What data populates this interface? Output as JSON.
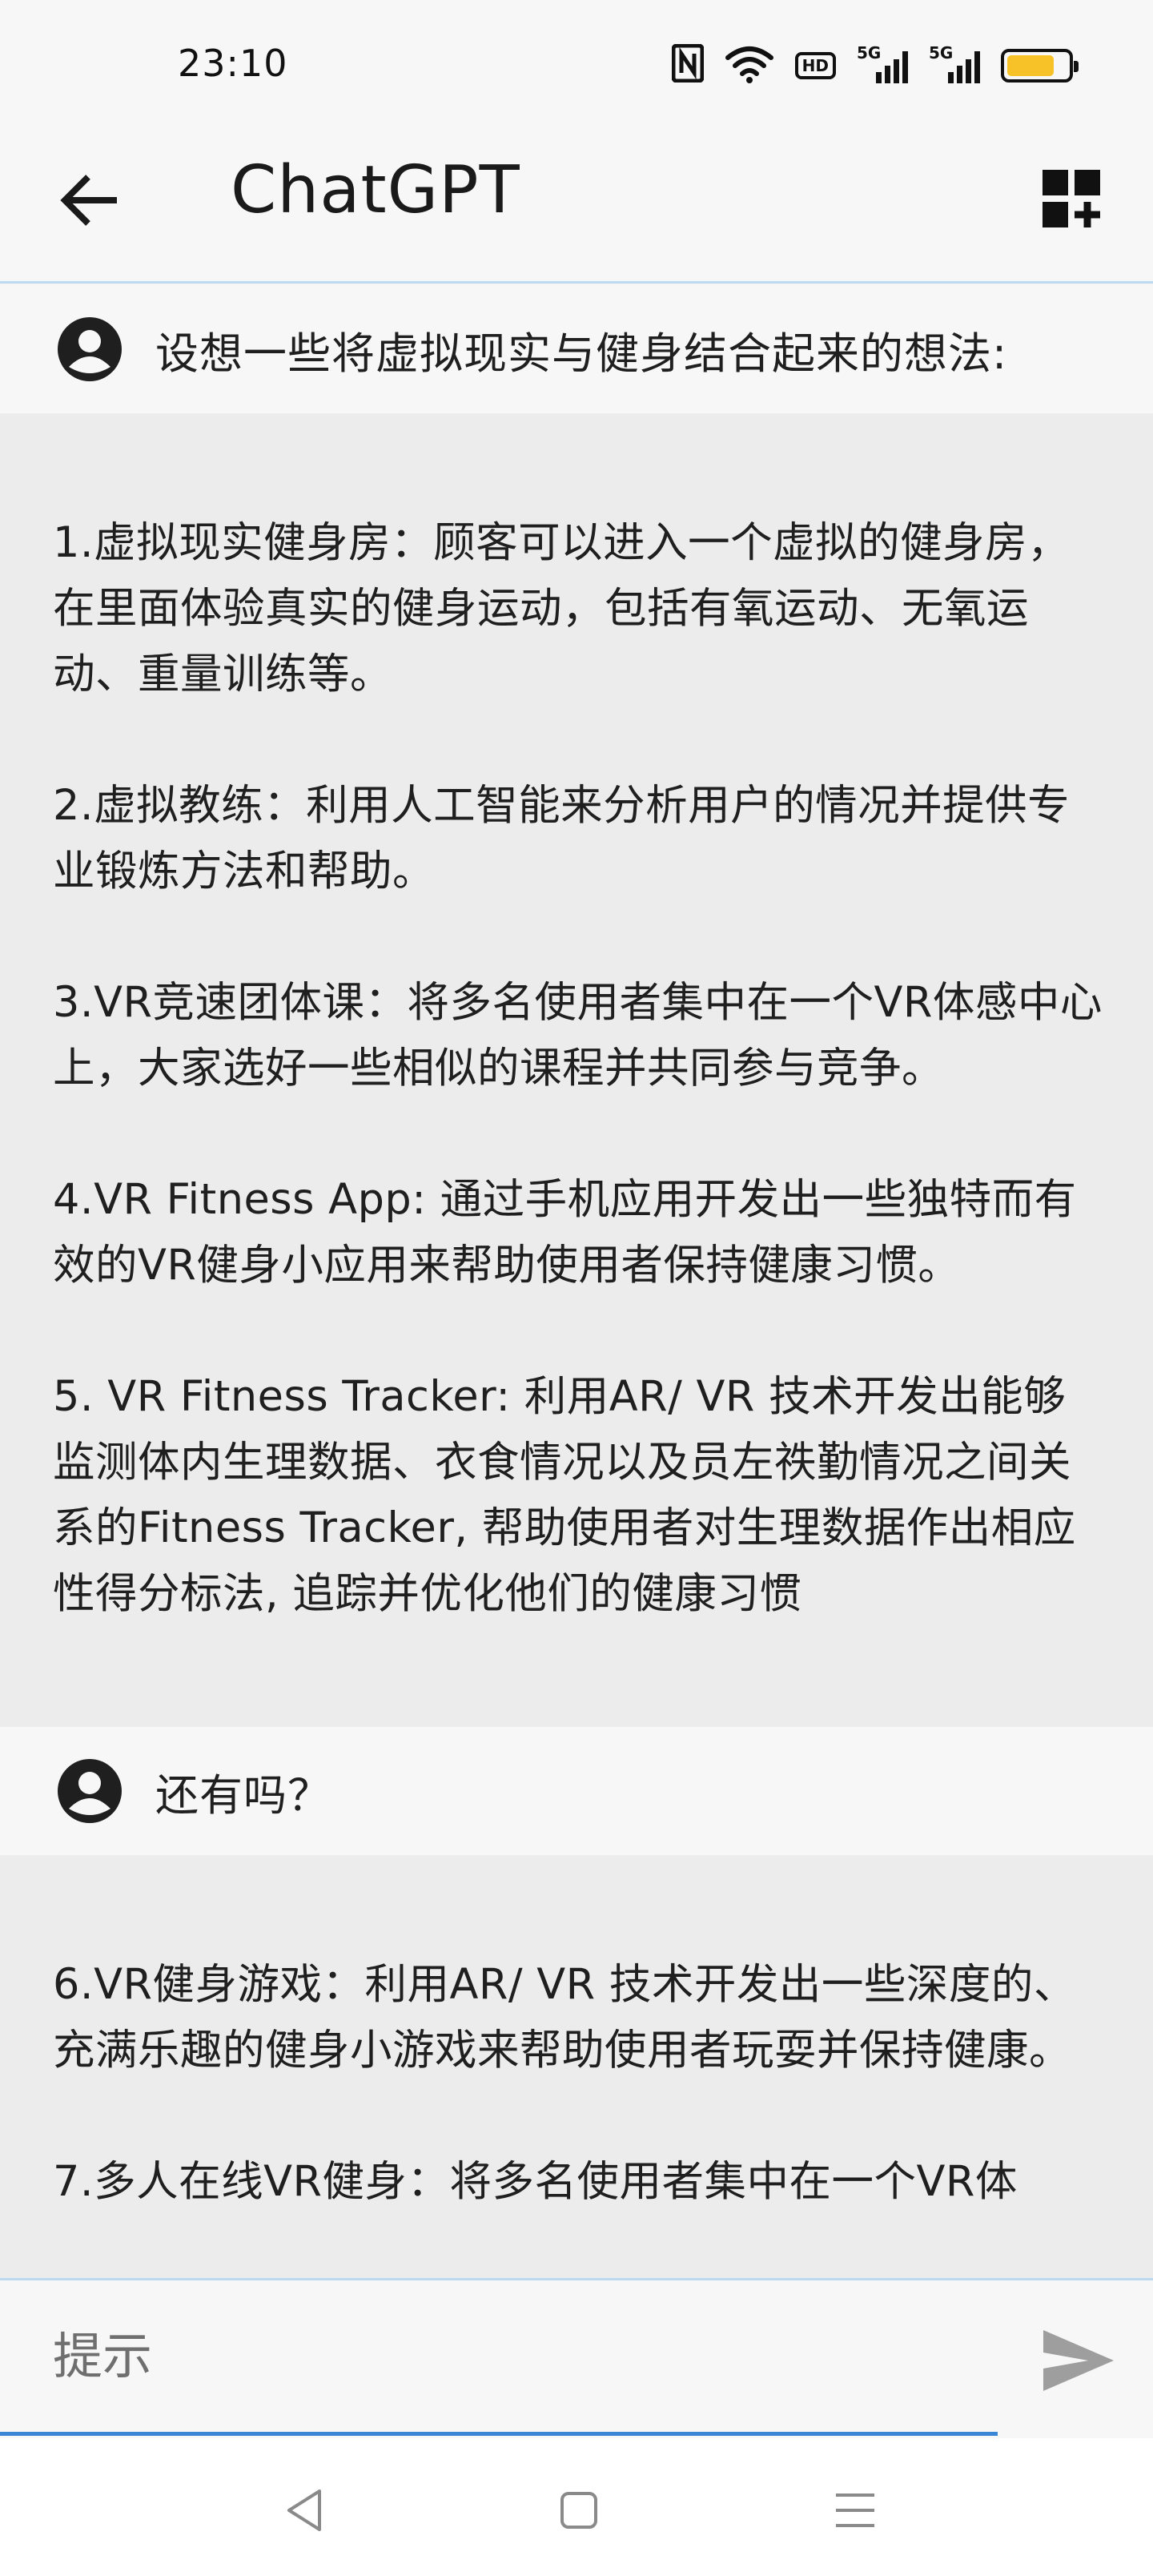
{
  "status_bar": {
    "time": "23:10",
    "icons": [
      "nfc-icon",
      "wifi-icon",
      "hd-icon",
      "signal-5g-icon",
      "signal-5g-icon",
      "battery-icon"
    ],
    "hd_label": "HD",
    "network_1": "5G",
    "network_2": "5G",
    "battery_level": 0.8,
    "battery_color": "#f6c228"
  },
  "app_bar": {
    "title": "ChatGPT",
    "back_icon": "arrow-left-icon",
    "new_chat_icon": "grid-plus-icon"
  },
  "conversation": {
    "messages": [
      {
        "role": "user",
        "text": "设想一些将虚拟现实与健身结合起来的想法:"
      },
      {
        "role": "assistant",
        "paragraphs": [
          "1.虚拟现实健身房：顾客可以进入一个虚拟的健身房，在里面体验真实的健身运动，包括有氧运动、无氧运动、重量训练等。",
          "2.虚拟教练：利用人工智能来分析用户的情况并提供专业锻炼方法和帮助。",
          "3.VR竞速团体课：将多名使用者集中在一个VR体感中心上，大家选好一些相似的课程并共同参与竞争。",
          "4.VR Fitness App: 通过手机应用开发出一些独特而有效的VR健身小应用来帮助使用者保持健康习惯。",
          "5. VR Fitness Tracker: 利用AR/ VR 技术开发出能够监测体内生理数据、衣食情况以及员左祑勤情况之间关系的Fitness Tracker, 帮助使用者对生理数据作出相应性得分标法, 追踪并优化他们的健康习惯"
        ]
      },
      {
        "role": "user",
        "text": "还有吗？"
      },
      {
        "role": "assistant",
        "paragraphs": [
          "6.VR健身游戏：利用AR/ VR 技术开发出一些深度的、充满乐趣的健身小游戏来帮助使用者玩耍并保持健康。",
          "7.多人在线VR健身：将多名使用者集中在一个VR体"
        ]
      }
    ]
  },
  "input": {
    "placeholder": "提示",
    "value": "",
    "send_icon": "send-icon",
    "accent_color": "#3a86d6"
  },
  "nav_bar": {
    "icons": [
      "back-triangle-icon",
      "home-square-icon",
      "menu-lines-icon"
    ]
  }
}
